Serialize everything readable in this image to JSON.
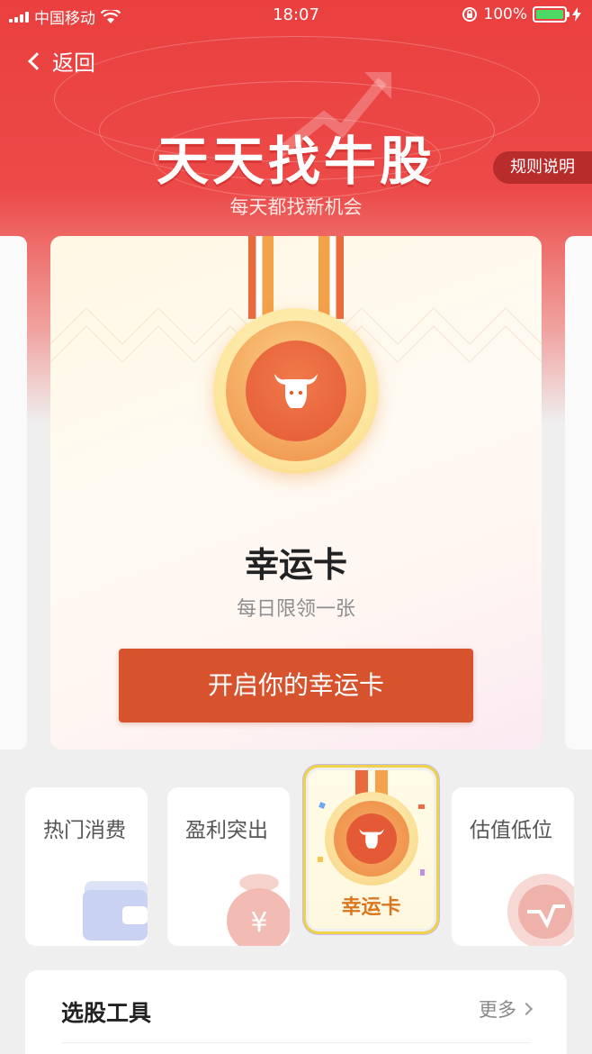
{
  "status_bar": {
    "carrier": "中国移动",
    "time": "18:07",
    "battery": "100%",
    "icons": [
      "signal-icon",
      "wifi-icon",
      "lock-rotation-icon",
      "battery-icon",
      "charging-icon"
    ]
  },
  "nav": {
    "back_label": "返回"
  },
  "header": {
    "title": "天天找牛股",
    "subtitle": "每天都找新机会",
    "rules_label": "规则说明"
  },
  "main_card": {
    "title": "幸运卡",
    "subtitle": "每日限领一张",
    "cta_label": "开启你的幸运卡",
    "icon": "bull-icon"
  },
  "tiles": [
    {
      "label": "热门消费",
      "icon": "wallet-icon"
    },
    {
      "label": "盈利突出",
      "icon": "money-bag-icon"
    },
    {
      "label": "幸运卡",
      "icon": "bull-icon",
      "selected": true
    },
    {
      "label": "估值低位",
      "icon": "trend-down-icon"
    }
  ],
  "tools": {
    "title": "选股工具",
    "more_label": "更多"
  },
  "colors": {
    "brand_red": "#ea3f3f",
    "cta": "#d6532e",
    "medal_orange": "#ee8a45",
    "lucky_label": "#d9761e"
  }
}
